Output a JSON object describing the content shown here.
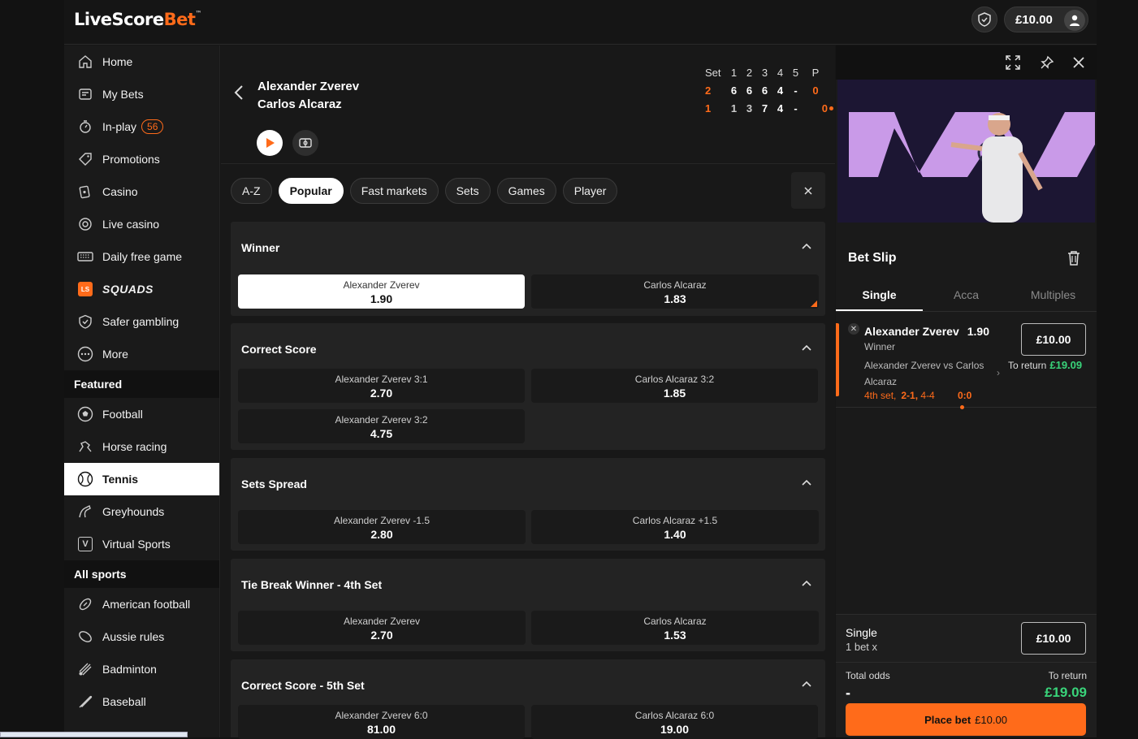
{
  "header": {
    "logo_a": "LiveScore",
    "logo_b": "Bet",
    "logo_tm": "™",
    "balance": "£10.00"
  },
  "sidebar": {
    "items": [
      {
        "label": "Home",
        "icon": "home-icon"
      },
      {
        "label": "My Bets",
        "icon": "my-bets-icon"
      },
      {
        "label": "In-play",
        "icon": "stopwatch-icon",
        "badge": "56"
      },
      {
        "label": "Promotions",
        "icon": "tag-icon"
      },
      {
        "label": "Casino",
        "icon": "cards-icon"
      },
      {
        "label": "Live casino",
        "icon": "chip-icon"
      },
      {
        "label": "Daily free game",
        "icon": "keyboard-icon"
      },
      {
        "label": "SQUADS",
        "icon": "squads-logo-icon",
        "ls": "LS"
      },
      {
        "label": "Safer gambling",
        "icon": "shield-icon"
      },
      {
        "label": "More",
        "icon": "more-icon"
      }
    ],
    "featured_heading": "Featured",
    "featured": [
      {
        "label": "Football",
        "icon": "football-icon"
      },
      {
        "label": "Horse racing",
        "icon": "horse-icon"
      },
      {
        "label": "Tennis",
        "icon": "tennis-ball-icon"
      },
      {
        "label": "Greyhounds",
        "icon": "greyhound-icon"
      },
      {
        "label": "Virtual Sports",
        "icon": "virtual-icon",
        "v": "V"
      }
    ],
    "all_heading": "All sports",
    "all": [
      {
        "label": "American football",
        "icon": "american-football-icon"
      },
      {
        "label": "Aussie rules",
        "icon": "aussie-rules-icon"
      },
      {
        "label": "Badminton",
        "icon": "shuttlecock-icon"
      },
      {
        "label": "Baseball",
        "icon": "baseball-bat-icon"
      }
    ]
  },
  "match": {
    "player1": "Alexander Zverev",
    "player2": "Carlos Alcaraz",
    "score_head": [
      "Set",
      "1",
      "2",
      "3",
      "4",
      "5",
      "P"
    ],
    "score_p1": [
      "2",
      "6",
      "6",
      "6",
      "4",
      "-",
      "0"
    ],
    "score_p2": [
      "1",
      "1",
      "3",
      "7",
      "4",
      "-",
      "0"
    ]
  },
  "tabs": [
    "A-Z",
    "Popular",
    "Fast markets",
    "Sets",
    "Games",
    "Player"
  ],
  "markets": {
    "winner": {
      "title": "Winner",
      "o1": {
        "name": "Alexander Zverev",
        "price": "1.90"
      },
      "o2": {
        "name": "Carlos Alcaraz",
        "price": "1.83"
      }
    },
    "correct_score": {
      "title": "Correct Score",
      "o1": {
        "name": "Alexander Zverev 3:1",
        "price": "2.70"
      },
      "o2": {
        "name": "Carlos Alcaraz 3:2",
        "price": "1.85"
      },
      "o3": {
        "name": "Alexander Zverev 3:2",
        "price": "4.75"
      }
    },
    "sets_spread": {
      "title": "Sets Spread",
      "o1": {
        "name": "Alexander Zverev -1.5",
        "price": "2.80"
      },
      "o2": {
        "name": "Carlos Alcaraz +1.5",
        "price": "1.40"
      }
    },
    "tie_break": {
      "title": "Tie Break Winner - 4th Set",
      "o1": {
        "name": "Alexander Zverev",
        "price": "2.70"
      },
      "o2": {
        "name": "Carlos Alcaraz",
        "price": "1.53"
      }
    },
    "cs5": {
      "title": "Correct Score - 5th Set",
      "o1": {
        "name": "Alexander Zverev 6:0",
        "price": "81.00"
      },
      "o2": {
        "name": "Carlos Alcaraz 6:0",
        "price": "19.00"
      }
    }
  },
  "betslip": {
    "title": "Bet Slip",
    "tabs": [
      "Single",
      "Acca",
      "Multiples"
    ],
    "selection": "Alexander Zverev",
    "odds": "1.90",
    "market": "Winner",
    "event": "Alexander Zverev vs Carlos Alcaraz",
    "live_set": "4th set,",
    "live_sets": "2-1,",
    "live_games": "4-4",
    "live_points": "0:0",
    "stake": "£10.00",
    "to_return_label": "To return",
    "to_return": "£19.09",
    "footer": {
      "single": "Single",
      "count": "1 bet x",
      "stake": "£10.00",
      "total_odds_label": "Total odds",
      "total_odds": "-",
      "to_return_label": "To return",
      "to_return": "£19.09",
      "place_label": "Place bet",
      "place_amount": "£10.00"
    }
  },
  "colors": {
    "accent": "#ff6b1a",
    "positive": "#39d47a"
  }
}
